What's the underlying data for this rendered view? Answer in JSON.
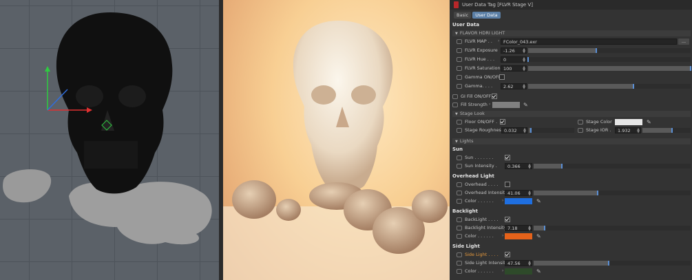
{
  "window": {
    "title": "User Data Tag [FLVR Stage V]"
  },
  "tabs": [
    {
      "label": "Basic",
      "active": false
    },
    {
      "label": "User Data",
      "active": true
    }
  ],
  "section_title": "User Data",
  "hdri": {
    "group_label": "FLAVOR HDRI LIGHT",
    "map": {
      "label": "FLVR MAP . .",
      "value": "FColor_043.exr",
      "browse": "..."
    },
    "exposure": {
      "label": "FLVR Exposure",
      "value": "-1.26",
      "fraction": 0.42
    },
    "hue": {
      "label": "FLVR Hue . . .",
      "value": "0",
      "fraction": 0.0
    },
    "saturation": {
      "label": "FLVR Saturation",
      "value": "100",
      "fraction": 1.0
    },
    "gamma_onoff": {
      "label": "Gamma ON/OFF",
      "checked": false
    },
    "gamma": {
      "label": "Gamma. . . .",
      "value": "2.62",
      "fraction": 0.65
    }
  },
  "gi": {
    "gi_fill": {
      "label": "GI Fill ON/OFF",
      "checked": true
    },
    "fill_strength": {
      "label": "Fill Strength",
      "color": "#808080"
    }
  },
  "stage": {
    "group_label": "Stage Look",
    "floor": {
      "label": "Floor ON/OFF .",
      "checked": true
    },
    "stage_color": {
      "label": "Stage Color",
      "color": "#e6e6e6"
    },
    "roughness": {
      "label": "Stage Roughness",
      "value": "0.032",
      "fraction": 0.04
    },
    "ior": {
      "label": "Stage IOR .",
      "value": "1.932",
      "fraction": 0.62
    }
  },
  "lights": {
    "group_label": "Lights",
    "sun": {
      "title": "Sun",
      "toggle": {
        "label": "Sun . . . . . . .",
        "checked": true
      },
      "intensity": {
        "label": "Sun Intensity .",
        "value": "0.366",
        "fraction": 0.18
      }
    },
    "overhead": {
      "title": "Overhead Light",
      "toggle": {
        "label": "Overhead . . . .",
        "checked": false
      },
      "intensity": {
        "label": "Overhead Intensity",
        "value": "41.06",
        "fraction": 0.41
      },
      "color": {
        "label": "Color . . . . . .",
        "color": "#1f6fe0"
      }
    },
    "backlight": {
      "title": "Backlight",
      "toggle": {
        "label": "BackLight . . . .",
        "checked": true
      },
      "intensity": {
        "label": "Backlight Intensity",
        "value": "7.18",
        "fraction": 0.07
      },
      "color": {
        "label": "Color . . . . . .",
        "color": "#e5621a"
      }
    },
    "side": {
      "title": "Side Light",
      "toggle": {
        "label": "Side Light . . . .",
        "checked": true
      },
      "intensity": {
        "label": "Side Light Intensity",
        "value": "47.56",
        "fraction": 0.48
      },
      "color": {
        "label": "Color . . . . . .",
        "color": "#2e4a2a"
      }
    }
  },
  "colors": {
    "panel_bg": "#333333",
    "accent_blue": "#5b7fa6",
    "title_orange": "#e89a3c"
  }
}
